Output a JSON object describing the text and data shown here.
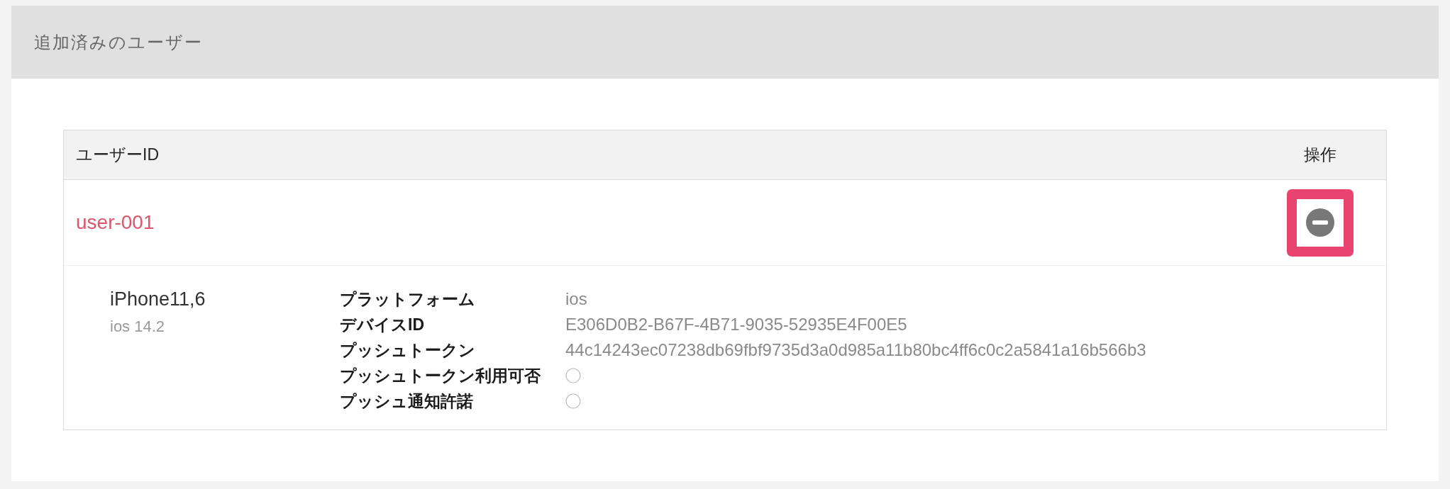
{
  "panel": {
    "title": "追加済みのユーザー"
  },
  "table": {
    "columns": [
      {
        "label": "ユーザーID"
      },
      {
        "label": "操作"
      }
    ],
    "rows": [
      {
        "user_id": "user-001",
        "action": {
          "highlighted": true
        },
        "devices": [
          {
            "model": "iPhone11,6",
            "os": "ios 14.2",
            "fields": [
              {
                "kind": "text",
                "label": "プラットフォーム",
                "value": "ios"
              },
              {
                "kind": "text",
                "label": "デバイスID",
                "value": "E306D0B2-B67F-4B71-9035-52935E4F00E5"
              },
              {
                "kind": "text",
                "label": "プッシュトークン",
                "value": "44c14243ec07238db69fbf9735d3a0d985a11b80bc4ff6c0c2a5841a16b566b3"
              },
              {
                "kind": "flag",
                "label": "プッシュトークン利用可否",
                "checked": false
              },
              {
                "kind": "flag",
                "label": "プッシュ通知許諾",
                "checked": false
              }
            ]
          }
        ]
      }
    ]
  }
}
